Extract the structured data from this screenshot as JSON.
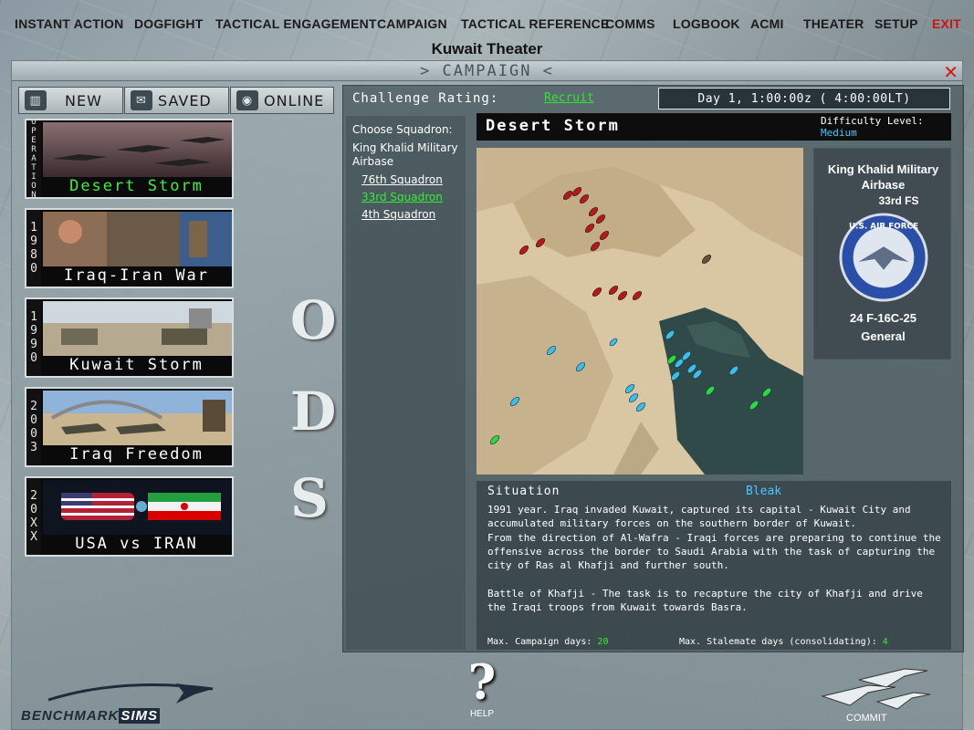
{
  "top_menu": {
    "items": [
      "INSTANT ACTION",
      "DOGFIGHT",
      "TACTICAL ENGAGEMENT",
      "CAMPAIGN",
      "TACTICAL REFERENCE",
      "COMMS",
      "LOGBOOK",
      "ACMI",
      "THEATER",
      "SETUP"
    ],
    "exit": "EXIT"
  },
  "theater_title": "Kuwait Theater",
  "window": {
    "title": "> CAMPAIGN <",
    "close": "✕"
  },
  "tabs": {
    "new": "NEW",
    "saved": "SAVED",
    "online": "ONLINE"
  },
  "campaigns": [
    {
      "side": "OPERATION",
      "name": "Desert Storm"
    },
    {
      "side": "1980",
      "name": "Iraq-Iran War"
    },
    {
      "side": "1990",
      "name": "Kuwait Storm"
    },
    {
      "side": "2003",
      "name": "Iraq Freedom"
    },
    {
      "side": "20XX",
      "name": "USA vs IRAN"
    }
  ],
  "ods_letters": [
    "O",
    "D",
    "S"
  ],
  "challenge": {
    "label": "Challenge Rating:",
    "value": "Recruit"
  },
  "clock": "Day 1, 1:00:00z ( 4:00:00LT)",
  "squadron": {
    "title": "Choose Squadron:",
    "base": "King Khalid Military Airbase",
    "items": [
      "76th Squadron",
      "33rd Squadron",
      "4th Squadron"
    ]
  },
  "campaign_header": {
    "name": "Desert Storm",
    "difficulty_label": "Difficulty Level:",
    "difficulty_value": "Medium"
  },
  "unit": {
    "base": "King Khalid Military Airbase",
    "squadron": "33rd FS",
    "patch_text": "U.S. AIR FORCE",
    "aircraft": "24 F-16C-25",
    "pilot": "General"
  },
  "situation": {
    "title": "Situation",
    "value": "Bleak",
    "paragraphs": [
      "1991 year. Iraq invaded Kuwait, captured its capital - Kuwait City and accumulated military forces on the southern border of Kuwait.",
      "From the direction of Al-Wafra - Iraqi forces are preparing to continue the offensive across the border to Saudi Arabia with the task of capturing the city of Ras al Khafji and further south.",
      "Battle of Khafji - The task is to recapture the city of Khafji and drive the Iraqi troops from Kuwait towards Basra."
    ],
    "max_campaign_label": "Max. Campaign days:",
    "max_campaign_value": "20",
    "max_stalemate_label": "Max. Stalemate days (consolidating):",
    "max_stalemate_value": "4"
  },
  "bottom": {
    "help": "HELP",
    "commit": "COMMIT",
    "logo_a": "BENCHMARK",
    "logo_b": "SIMS"
  },
  "colors": {
    "accent_green": "#35ec35",
    "accent_blue": "#46c8ff",
    "exit_red": "#c81414"
  }
}
